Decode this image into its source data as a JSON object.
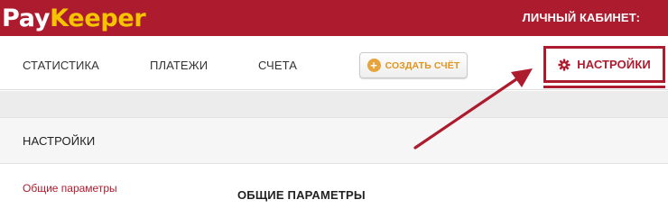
{
  "header": {
    "logo_tick": "✓",
    "logo_pay": "Pay",
    "logo_keeper": "Keeper",
    "account_label": "ЛИЧНЫЙ КАБИНЕТ:"
  },
  "nav": {
    "items": [
      {
        "label": "СТАТИСТИКА"
      },
      {
        "label": "ПЛАТЕЖИ"
      },
      {
        "label": "СЧЕТА"
      }
    ],
    "create_button": {
      "icon": "+",
      "label": "СОЗДАТЬ СЧЁТ"
    },
    "settings_tab": {
      "label": "НАСТРОЙКИ",
      "icon": "gear-icon"
    }
  },
  "section": {
    "title": "НАСТРОЙКИ"
  },
  "sidebar": {
    "active_link": "Общие параметры"
  },
  "content": {
    "title": "ОБЩИЕ ПАРАМЕТРЫ"
  },
  "colors": {
    "brand_red": "#ad1b2e",
    "logo_yellow": "#f5c400",
    "accent_orange": "#e8a43c"
  }
}
